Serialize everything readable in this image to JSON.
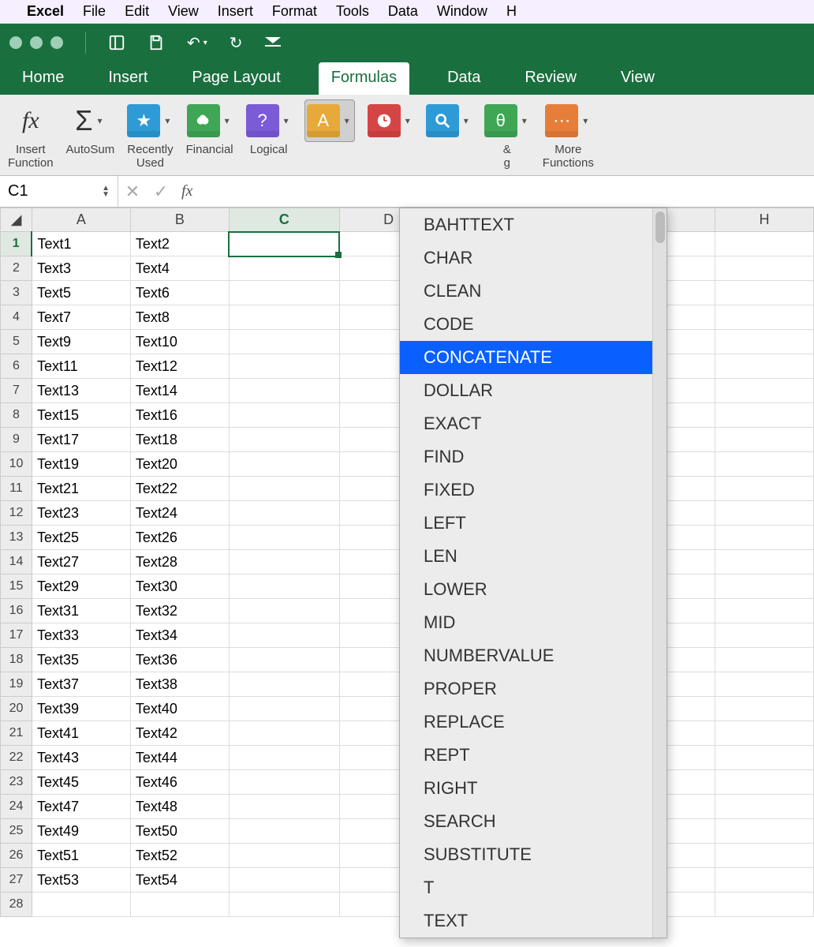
{
  "mac_menu": {
    "app": "Excel",
    "items": [
      "File",
      "Edit",
      "View",
      "Insert",
      "Format",
      "Tools",
      "Data",
      "Window",
      "H"
    ]
  },
  "ribbon_tabs": [
    "Home",
    "Insert",
    "Page Layout",
    "Formulas",
    "Data",
    "Review",
    "View"
  ],
  "active_tab": "Formulas",
  "ribbon_groups": {
    "insert_function": "Insert\nFunction",
    "autosum": "AutoSum",
    "recently_used": "Recently\nUsed",
    "financial": "Financial",
    "logical": "Logical",
    "trig_partial": "&\ng",
    "more_functions": "More\nFunctions"
  },
  "name_box": "C1",
  "formula_value": "",
  "columns": [
    "A",
    "B",
    "C",
    "D",
    "",
    "H"
  ],
  "rows": [
    {
      "n": 1,
      "a": "Text1",
      "b": "Text2"
    },
    {
      "n": 2,
      "a": "Text3",
      "b": "Text4"
    },
    {
      "n": 3,
      "a": "Text5",
      "b": "Text6"
    },
    {
      "n": 4,
      "a": "Text7",
      "b": "Text8"
    },
    {
      "n": 5,
      "a": "Text9",
      "b": "Text10"
    },
    {
      "n": 6,
      "a": "Text11",
      "b": "Text12"
    },
    {
      "n": 7,
      "a": "Text13",
      "b": "Text14"
    },
    {
      "n": 8,
      "a": "Text15",
      "b": "Text16"
    },
    {
      "n": 9,
      "a": "Text17",
      "b": "Text18"
    },
    {
      "n": 10,
      "a": "Text19",
      "b": "Text20"
    },
    {
      "n": 11,
      "a": "Text21",
      "b": "Text22"
    },
    {
      "n": 12,
      "a": "Text23",
      "b": "Text24"
    },
    {
      "n": 13,
      "a": "Text25",
      "b": "Text26"
    },
    {
      "n": 14,
      "a": "Text27",
      "b": "Text28"
    },
    {
      "n": 15,
      "a": "Text29",
      "b": "Text30"
    },
    {
      "n": 16,
      "a": "Text31",
      "b": "Text32"
    },
    {
      "n": 17,
      "a": "Text33",
      "b": "Text34"
    },
    {
      "n": 18,
      "a": "Text35",
      "b": "Text36"
    },
    {
      "n": 19,
      "a": "Text37",
      "b": "Text38"
    },
    {
      "n": 20,
      "a": "Text39",
      "b": "Text40"
    },
    {
      "n": 21,
      "a": "Text41",
      "b": "Text42"
    },
    {
      "n": 22,
      "a": "Text43",
      "b": "Text44"
    },
    {
      "n": 23,
      "a": "Text45",
      "b": "Text46"
    },
    {
      "n": 24,
      "a": "Text47",
      "b": "Text48"
    },
    {
      "n": 25,
      "a": "Text49",
      "b": "Text50"
    },
    {
      "n": 26,
      "a": "Text51",
      "b": "Text52"
    },
    {
      "n": 27,
      "a": "Text53",
      "b": "Text54"
    },
    {
      "n": 28,
      "a": "",
      "b": ""
    }
  ],
  "dropdown_items": [
    "BAHTTEXT",
    "CHAR",
    "CLEAN",
    "CODE",
    "CONCATENATE",
    "DOLLAR",
    "EXACT",
    "FIND",
    "FIXED",
    "LEFT",
    "LEN",
    "LOWER",
    "MID",
    "NUMBERVALUE",
    "PROPER",
    "REPLACE",
    "REPT",
    "RIGHT",
    "SEARCH",
    "SUBSTITUTE",
    "T",
    "TEXT"
  ],
  "dropdown_highlight": "CONCATENATE",
  "colors": {
    "accent": "#1a6f3f",
    "highlight": "#0a60ff"
  }
}
